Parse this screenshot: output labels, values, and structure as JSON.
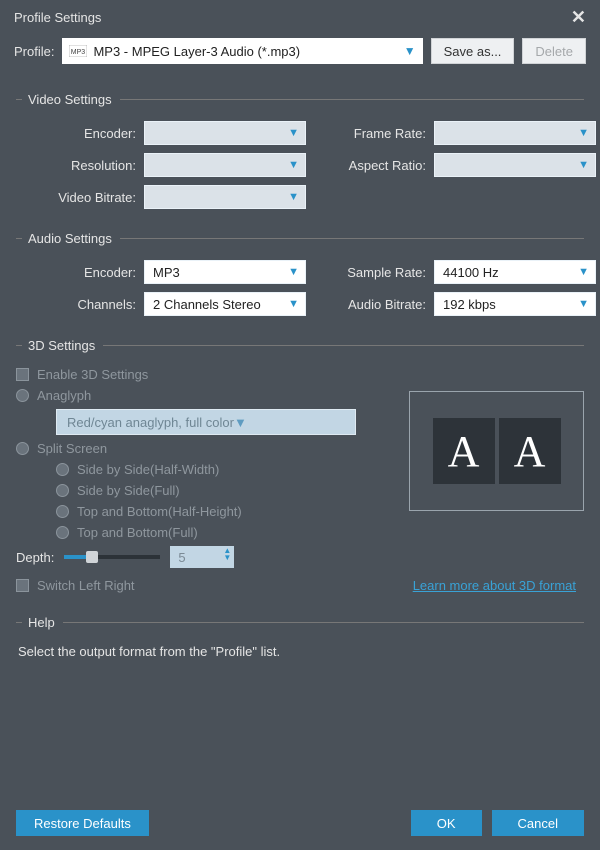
{
  "window": {
    "title": "Profile Settings"
  },
  "profile": {
    "label": "Profile:",
    "selected": "MP3 - MPEG Layer-3 Audio (*.mp3)",
    "icon_name": "mp3-icon",
    "save_as": "Save as...",
    "delete": "Delete"
  },
  "video": {
    "heading": "Video Settings",
    "encoder_label": "Encoder:",
    "encoder": "",
    "resolution_label": "Resolution:",
    "resolution": "",
    "bitrate_label": "Video Bitrate:",
    "bitrate": "",
    "framerate_label": "Frame Rate:",
    "framerate": "",
    "aspect_label": "Aspect Ratio:",
    "aspect": ""
  },
  "audio": {
    "heading": "Audio Settings",
    "encoder_label": "Encoder:",
    "encoder": "MP3",
    "channels_label": "Channels:",
    "channels": "2 Channels Stereo",
    "samplerate_label": "Sample Rate:",
    "samplerate": "44100 Hz",
    "bitrate_label": "Audio Bitrate:",
    "bitrate": "192 kbps"
  },
  "threeD": {
    "heading": "3D Settings",
    "enable": "Enable 3D Settings",
    "anaglyph": "Anaglyph",
    "anaglyph_mode": "Red/cyan anaglyph, full color",
    "split": "Split Screen",
    "sbs_half": "Side by Side(Half-Width)",
    "sbs_full": "Side by Side(Full)",
    "tab_half": "Top and Bottom(Half-Height)",
    "tab_full": "Top and Bottom(Full)",
    "depth_label": "Depth:",
    "depth_value": "5",
    "switch": "Switch Left Right",
    "learn": "Learn more about 3D format",
    "preview_glyph": "A"
  },
  "help": {
    "heading": "Help",
    "text": "Select the output format from the \"Profile\" list."
  },
  "footer": {
    "restore": "Restore Defaults",
    "ok": "OK",
    "cancel": "Cancel"
  }
}
